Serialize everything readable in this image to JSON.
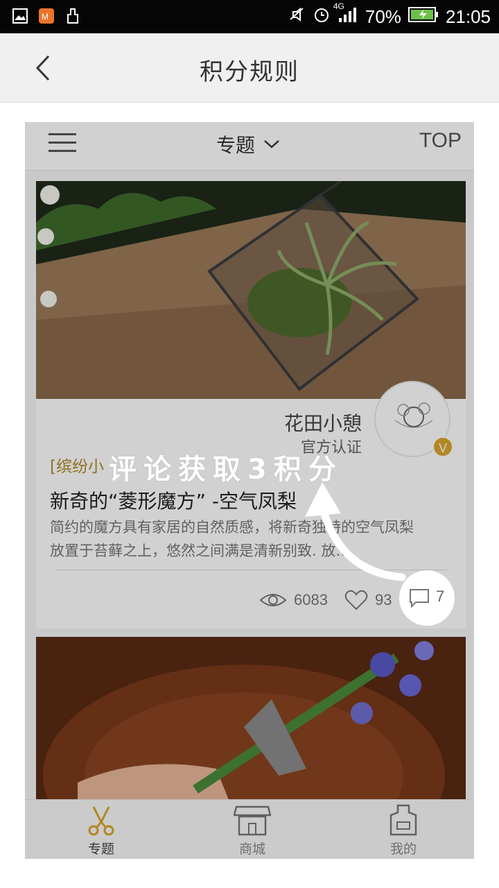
{
  "statusbar": {
    "network": "4G",
    "battery": "70%",
    "time": "21:05"
  },
  "header": {
    "title": "积分规则"
  },
  "preview": {
    "topbar": {
      "title": "专题",
      "top_label": "TOP"
    },
    "card": {
      "author": "花田小憩",
      "author_tag": "官方认证",
      "badge": "V",
      "category": "[缤纷小",
      "title": "新奇的“菱形魔方” -空气凤梨",
      "description": "简约的魔方具有家居的自然质感，将新奇独特的空气凤梨放置于苔藓之上，悠然之间满是清新别致. 放…",
      "views": "6083",
      "likes": "93",
      "comments": "7"
    },
    "tabs": [
      {
        "label": "专题",
        "icon": "scissors-icon"
      },
      {
        "label": "商城",
        "icon": "shop-icon"
      },
      {
        "label": "我的",
        "icon": "apron-icon"
      }
    ]
  },
  "overlay": {
    "hint": "评论获取3积分"
  },
  "colors": {
    "accent": "#d9a52b",
    "category": "#b08a2c"
  }
}
